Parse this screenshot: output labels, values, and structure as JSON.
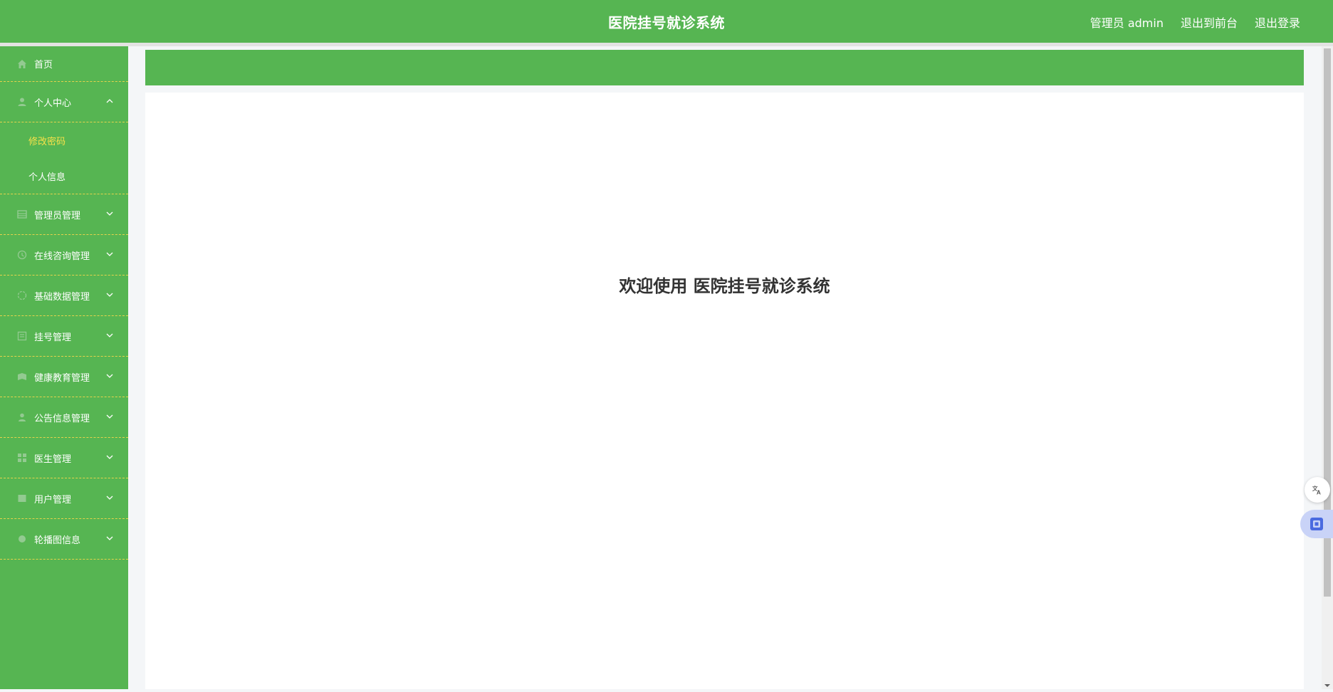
{
  "app": {
    "title": "医院挂号就诊系统"
  },
  "header": {
    "admin_label": "管理员 admin",
    "front_label": "退出到前台",
    "logout_label": "退出登录"
  },
  "sidebar": {
    "home": {
      "label": "首页",
      "icon": "home-icon"
    },
    "personal": {
      "label": "个人中心",
      "icon": "user-icon",
      "sub": [
        {
          "label": "修改密码",
          "active": true
        },
        {
          "label": "个人信息",
          "active": false
        }
      ]
    },
    "items": [
      {
        "label": "管理员管理",
        "icon": "table-icon"
      },
      {
        "label": "在线咨询管理",
        "icon": "chat-icon"
      },
      {
        "label": "基础数据管理",
        "icon": "data-icon"
      },
      {
        "label": "挂号管理",
        "icon": "register-icon"
      },
      {
        "label": "健康教育管理",
        "icon": "book-icon"
      },
      {
        "label": "公告信息管理",
        "icon": "notice-icon"
      },
      {
        "label": "医生管理",
        "icon": "grid-icon"
      },
      {
        "label": "用户管理",
        "icon": "users-icon"
      },
      {
        "label": "轮播图信息",
        "icon": "image-icon"
      }
    ]
  },
  "main": {
    "welcome": "欢迎使用 医院挂号就诊系统"
  },
  "colors": {
    "primary": "#56b552",
    "active_text": "#f6e14a",
    "divider": "#e6d34b"
  }
}
